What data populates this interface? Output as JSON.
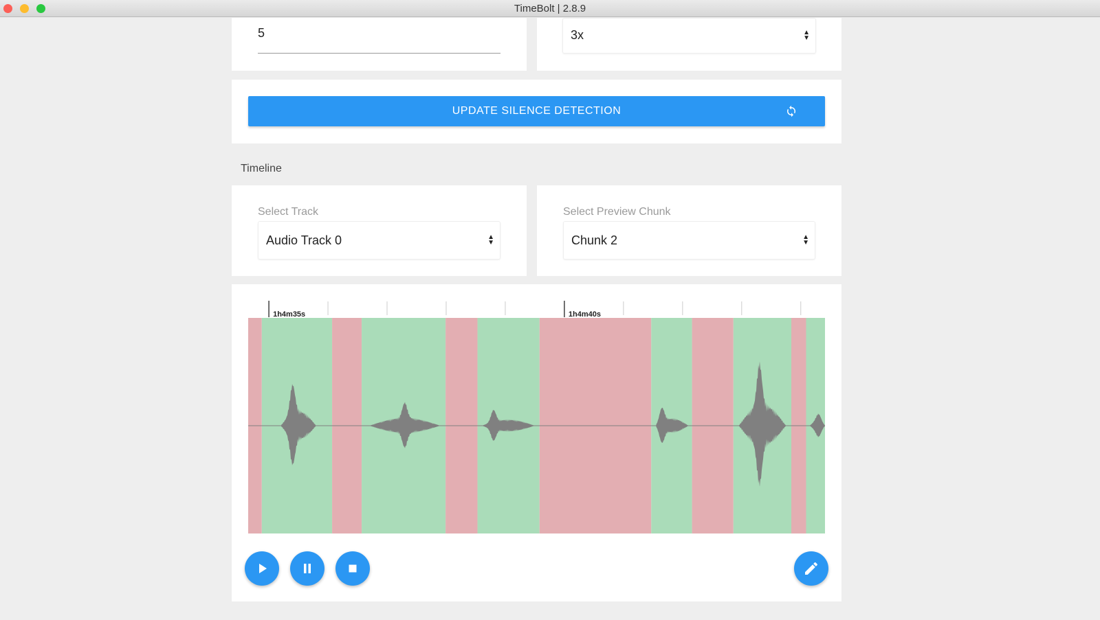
{
  "window": {
    "title": "TimeBolt | 2.8.9"
  },
  "settings": {
    "threshold_value": "5",
    "speed_value": "3x"
  },
  "update_button": {
    "label": "UPDATE SILENCE DETECTION",
    "icon": "refresh-icon"
  },
  "timeline": {
    "section_title": "Timeline",
    "track": {
      "label": "Select Track",
      "value": "Audio Track 0"
    },
    "chunk": {
      "label": "Select Preview Chunk",
      "value": "Chunk 2"
    },
    "time_labels": [
      {
        "t": 3875,
        "text": "1h4m35s"
      },
      {
        "t": 3880,
        "text": "1h4m40s"
      }
    ],
    "view_range_s": [
      3874.65,
      3884.41
    ],
    "segments": [
      {
        "type": "silence",
        "start": 3874.65,
        "end": 3874.88
      },
      {
        "type": "speech",
        "start": 3874.88,
        "end": 3876.07
      },
      {
        "type": "silence",
        "start": 3876.07,
        "end": 3876.57
      },
      {
        "type": "speech",
        "start": 3876.57,
        "end": 3877.99
      },
      {
        "type": "silence",
        "start": 3877.99,
        "end": 3878.53
      },
      {
        "type": "speech",
        "start": 3878.53,
        "end": 3879.58
      },
      {
        "type": "silence",
        "start": 3879.58,
        "end": 3881.47
      },
      {
        "type": "speech",
        "start": 3881.47,
        "end": 3882.16
      },
      {
        "type": "silence",
        "start": 3882.16,
        "end": 3882.86
      },
      {
        "type": "speech",
        "start": 3882.86,
        "end": 3883.84
      },
      {
        "type": "silence",
        "start": 3883.84,
        "end": 3884.09
      },
      {
        "type": "speech",
        "start": 3884.09,
        "end": 3884.41
      }
    ],
    "colors": {
      "speech": "#aadcb9",
      "silence": "#e3aeb2",
      "wave": "#808080",
      "accent": "#2b97f3"
    }
  },
  "controls": {
    "play": "play-icon",
    "pause": "pause-icon",
    "stop": "stop-icon",
    "edit": "pencil-icon"
  }
}
